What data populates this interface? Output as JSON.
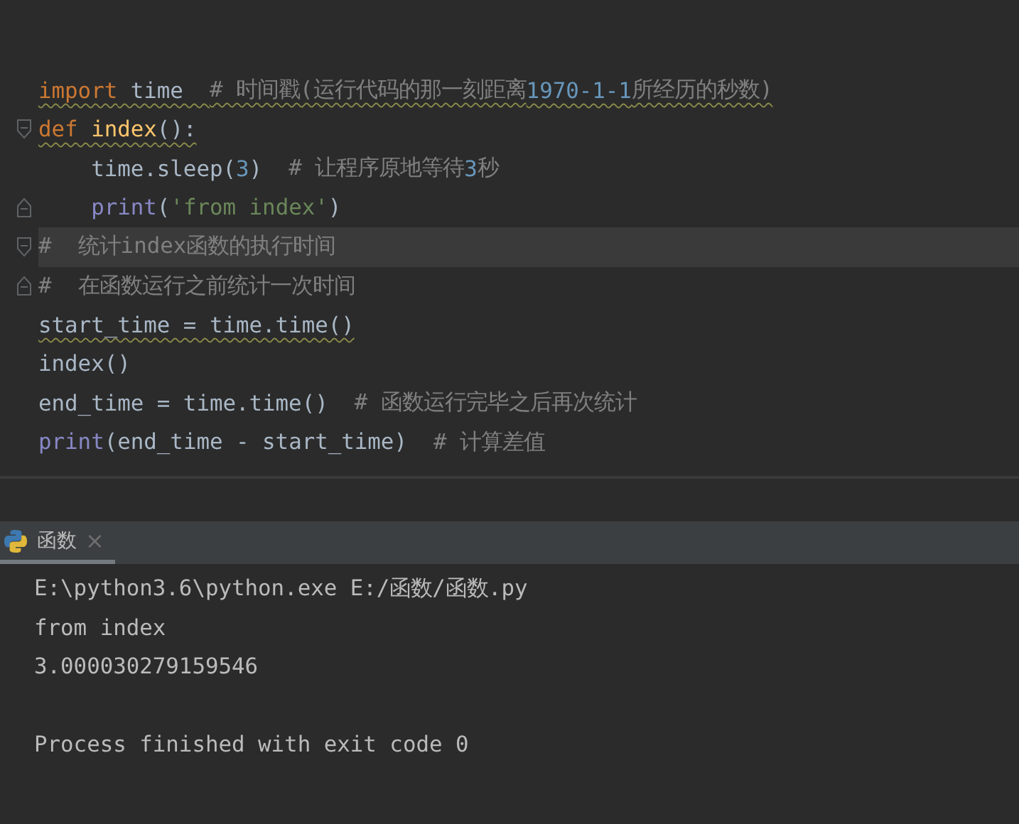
{
  "editor": {
    "lines": [
      {
        "fold_start": false,
        "fold_end": false,
        "current": false,
        "warning": true,
        "tokens": [
          {
            "kind": "keyword",
            "text": "import"
          },
          {
            "kind": "plain",
            "text": " time  "
          },
          {
            "kind": "comment",
            "text": "# 时间戳(运行代码的那一刻距离"
          },
          {
            "kind": "number",
            "text": "1970-1-1"
          },
          {
            "kind": "comment",
            "text": "所经历的秒数)"
          }
        ]
      },
      {
        "fold_start": true,
        "fold_end": false,
        "current": false,
        "warning": true,
        "tokens": [
          {
            "kind": "keyword",
            "text": "def"
          },
          {
            "kind": "function",
            "text": " index"
          },
          {
            "kind": "plain",
            "text": "():"
          }
        ]
      },
      {
        "fold_start": false,
        "fold_end": false,
        "current": false,
        "warning": false,
        "tokens": [
          {
            "kind": "plain",
            "text": "    time.sleep("
          },
          {
            "kind": "number",
            "text": "3"
          },
          {
            "kind": "plain",
            "text": ")  "
          },
          {
            "kind": "comment",
            "text": "# 让程序原地等待"
          },
          {
            "kind": "number",
            "text": "3"
          },
          {
            "kind": "comment",
            "text": "秒"
          }
        ]
      },
      {
        "fold_start": false,
        "fold_end": true,
        "current": false,
        "warning": false,
        "tokens": [
          {
            "kind": "builtin",
            "text": "    print"
          },
          {
            "kind": "plain",
            "text": "("
          },
          {
            "kind": "string",
            "text": "'from index'"
          },
          {
            "kind": "plain",
            "text": ")"
          }
        ]
      },
      {
        "fold_start": true,
        "fold_end": false,
        "current": true,
        "warning": false,
        "tokens": [
          {
            "kind": "comment",
            "text": "#  统计index函数的执行时间"
          }
        ]
      },
      {
        "fold_start": false,
        "fold_end": true,
        "current": false,
        "warning": false,
        "tokens": [
          {
            "kind": "comment",
            "text": "#  在函数运行之前统计一次时间"
          }
        ]
      },
      {
        "fold_start": false,
        "fold_end": false,
        "current": false,
        "warning": true,
        "tokens": [
          {
            "kind": "plain",
            "text": "start_time = time.time()"
          }
        ]
      },
      {
        "fold_start": false,
        "fold_end": false,
        "current": false,
        "warning": false,
        "tokens": [
          {
            "kind": "plain",
            "text": "index()"
          }
        ]
      },
      {
        "fold_start": false,
        "fold_end": false,
        "current": false,
        "warning": false,
        "tokens": [
          {
            "kind": "plain",
            "text": "end_time = time.time()  "
          },
          {
            "kind": "comment",
            "text": "# 函数运行完毕之后再次统计"
          }
        ]
      },
      {
        "fold_start": false,
        "fold_end": false,
        "current": false,
        "warning": false,
        "tokens": [
          {
            "kind": "builtin",
            "text": "print"
          },
          {
            "kind": "plain",
            "text": "(end_time - start_time)  "
          },
          {
            "kind": "comment",
            "text": "# 计算差值"
          }
        ]
      }
    ]
  },
  "run_panel": {
    "tabs": [
      {
        "label": "函数",
        "close": "×",
        "selected": true
      }
    ],
    "output": [
      "E:\\python3.6\\python.exe E:/函数/函数.py",
      "from index",
      "3.000030279159546"
    ],
    "exit_message": "Process finished with exit code 0"
  }
}
